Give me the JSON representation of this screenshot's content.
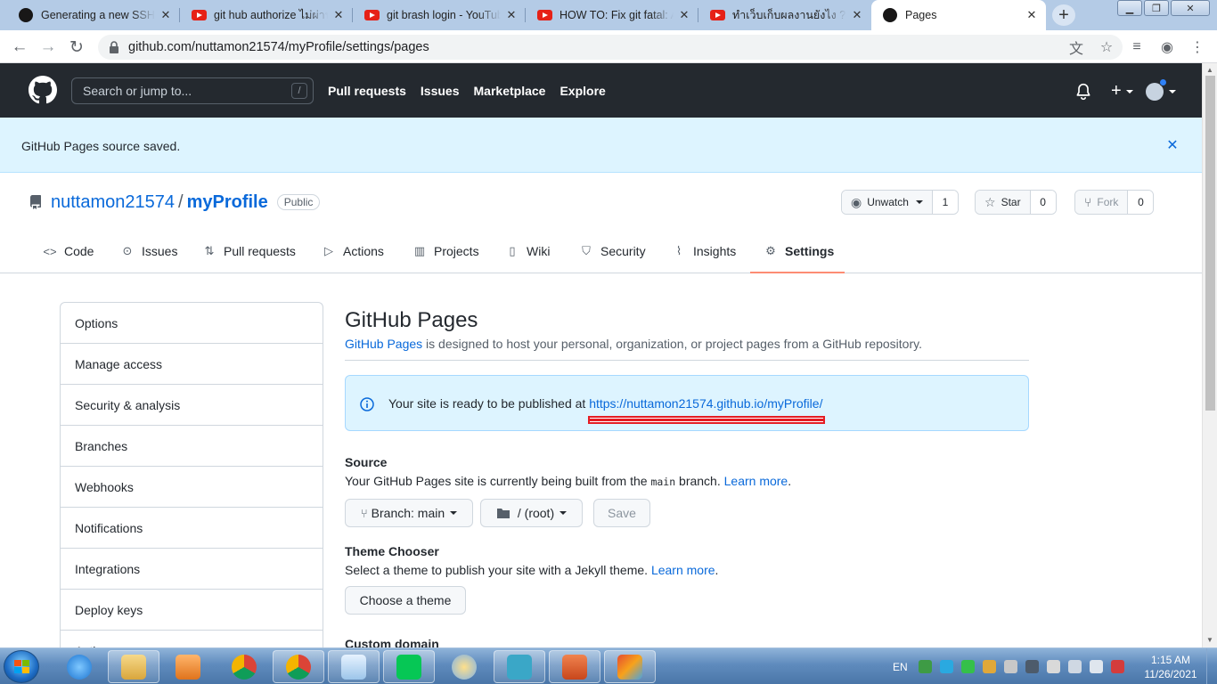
{
  "browser": {
    "tabs": [
      {
        "title": "Generating a new SSH key",
        "icon": "github-icon"
      },
      {
        "title": "git hub authorize ไม่ผ่าน",
        "icon": "youtube-icon"
      },
      {
        "title": "git brash login - YouTube",
        "icon": "youtube-icon"
      },
      {
        "title": "HOW TO: Fix git fatal: Au",
        "icon": "youtube-icon"
      },
      {
        "title": "ทำเว็บเก็บผลงานยังไง ? ส",
        "icon": "youtube-icon"
      },
      {
        "title": "Pages",
        "icon": "github-icon",
        "active": true
      }
    ],
    "url": "github.com/nuttamon21574/myProfile/settings/pages"
  },
  "github_header": {
    "search_placeholder": "Search or jump to...",
    "search_shortcut": "/",
    "nav": [
      "Pull requests",
      "Issues",
      "Marketplace",
      "Explore"
    ]
  },
  "flash": {
    "message": "GitHub Pages source saved."
  },
  "repo": {
    "owner": "nuttamon21574",
    "separator": "/",
    "name": "myProfile",
    "visibility": "Public",
    "watch": {
      "label": "Unwatch",
      "count": "1"
    },
    "star": {
      "label": "Star",
      "count": "0"
    },
    "fork": {
      "label": "Fork",
      "count": "0"
    },
    "tabs": [
      "Code",
      "Issues",
      "Pull requests",
      "Actions",
      "Projects",
      "Wiki",
      "Security",
      "Insights",
      "Settings"
    ],
    "selected_tab": "Settings"
  },
  "settings_menu": [
    "Options",
    "Manage access",
    "Security & analysis",
    "Branches",
    "Webhooks",
    "Notifications",
    "Integrations",
    "Deploy keys",
    "Actions"
  ],
  "pages": {
    "title": "GitHub Pages",
    "desc_link": "GitHub Pages",
    "desc_rest": " is designed to host your personal, organization, or project pages from a GitHub repository.",
    "notice_text": "Your site is ready to be published at ",
    "notice_link": "https://nuttamon21574.github.io/myProfile/",
    "source_label": "Source",
    "source_text_1": "Your GitHub Pages site is currently being built from the ",
    "source_branch_code": "main",
    "source_text_2": " branch. ",
    "learn_more": "Learn more",
    "branch_button": "Branch: main",
    "folder_button": "/ (root)",
    "save_button": "Save",
    "theme_label": "Theme Chooser",
    "theme_text": "Select a theme to publish your site with a Jekyll theme. ",
    "theme_button": "Choose a theme",
    "custom_domain_label": "Custom domain"
  },
  "taskbar": {
    "language": "EN",
    "time": "1:15 AM",
    "date": "11/26/2021"
  },
  "colors": {
    "link": "#0969da",
    "header_bg": "#24292f",
    "flash_bg": "#ddf4ff",
    "tab_underline": "#fd8c73",
    "annotation_red": "#e51c23"
  }
}
